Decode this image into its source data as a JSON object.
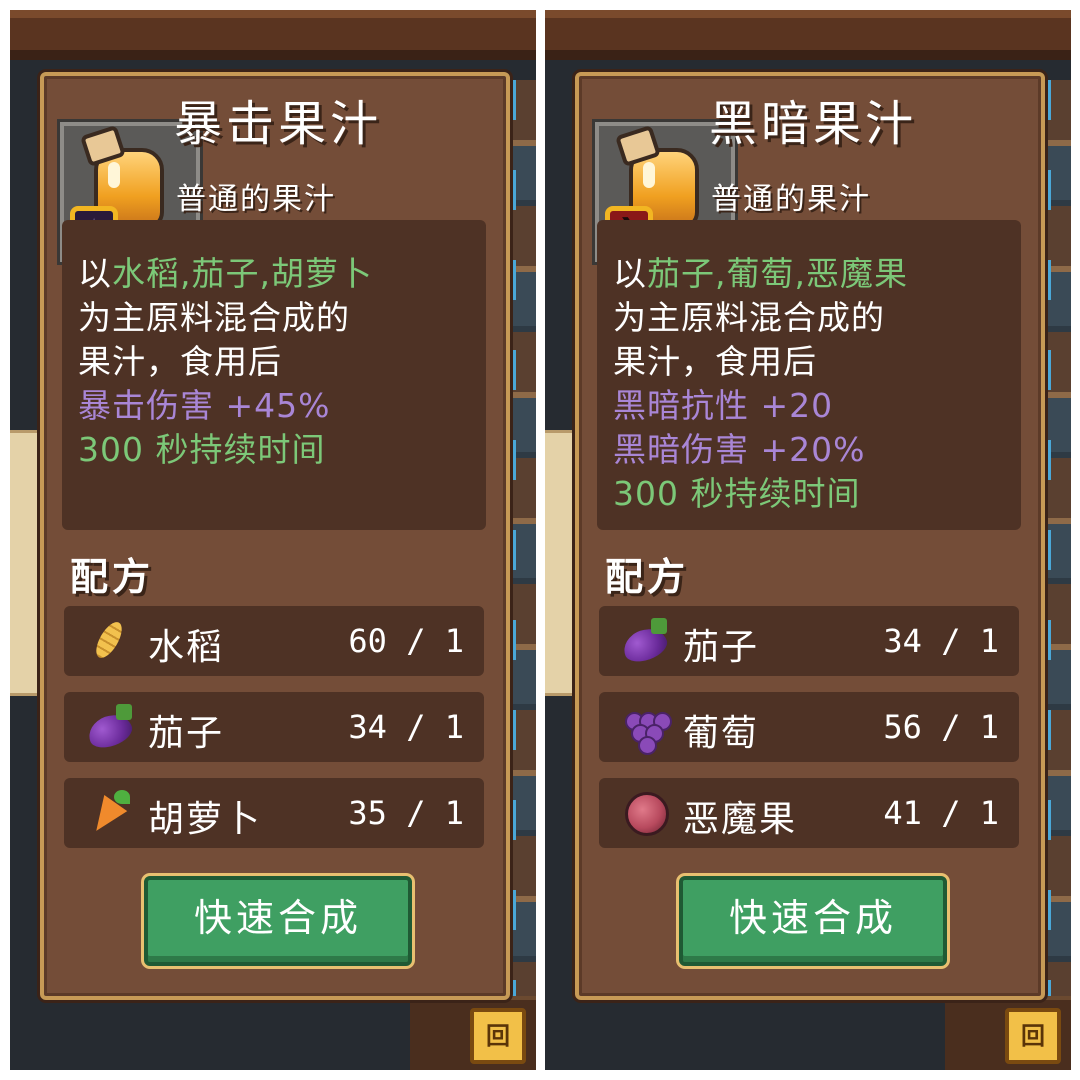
{
  "panels": [
    {
      "item_name": "暴击果汁",
      "rarity": "普通的果汁",
      "description": {
        "line1_prefix": "以",
        "line1_ingredients": "水稻,茄子,胡萝卜",
        "line2": "为主原料混合成的",
        "line3": "果汁，食用后",
        "effect1": "暴击伤害 +45%",
        "duration": "300 秒持续时间"
      },
      "recipe_title": "配方",
      "recipe": [
        {
          "name": "水稻",
          "count": "60 / 1",
          "icon": "rice-icon"
        },
        {
          "name": "茄子",
          "count": "34 / 1",
          "icon": "eggplant-icon"
        },
        {
          "name": "胡萝卜",
          "count": "35 / 1",
          "icon": "carrot-icon"
        }
      ],
      "button_label": "快速合成"
    },
    {
      "item_name": "黑暗果汁",
      "rarity": "普通的果汁",
      "description": {
        "line1_prefix": "以",
        "line1_ingredients": "茄子,葡萄,恶魔果",
        "line2": "为主原料混合成的",
        "line3": "果汁，食用后",
        "effect1": "黑暗抗性 +20",
        "effect2": "黑暗伤害 +20%",
        "duration": "300 秒持续时间"
      },
      "recipe_title": "配方",
      "recipe": [
        {
          "name": "茄子",
          "count": "34 / 1",
          "icon": "eggplant-icon"
        },
        {
          "name": "葡萄",
          "count": "56 / 1",
          "icon": "grape-icon"
        },
        {
          "name": "恶魔果",
          "count": "41 / 1",
          "icon": "demon-fruit-icon"
        }
      ],
      "button_label": "快速合成"
    }
  ],
  "colors": {
    "panel": "#744d38",
    "panel_border": "#c79a56",
    "inner_box": "#4e3225",
    "highlight_green": "#7cc878",
    "effect_purple": "#a986d6",
    "button_green": "#3f9f62"
  },
  "background_icon": "bag-icon"
}
